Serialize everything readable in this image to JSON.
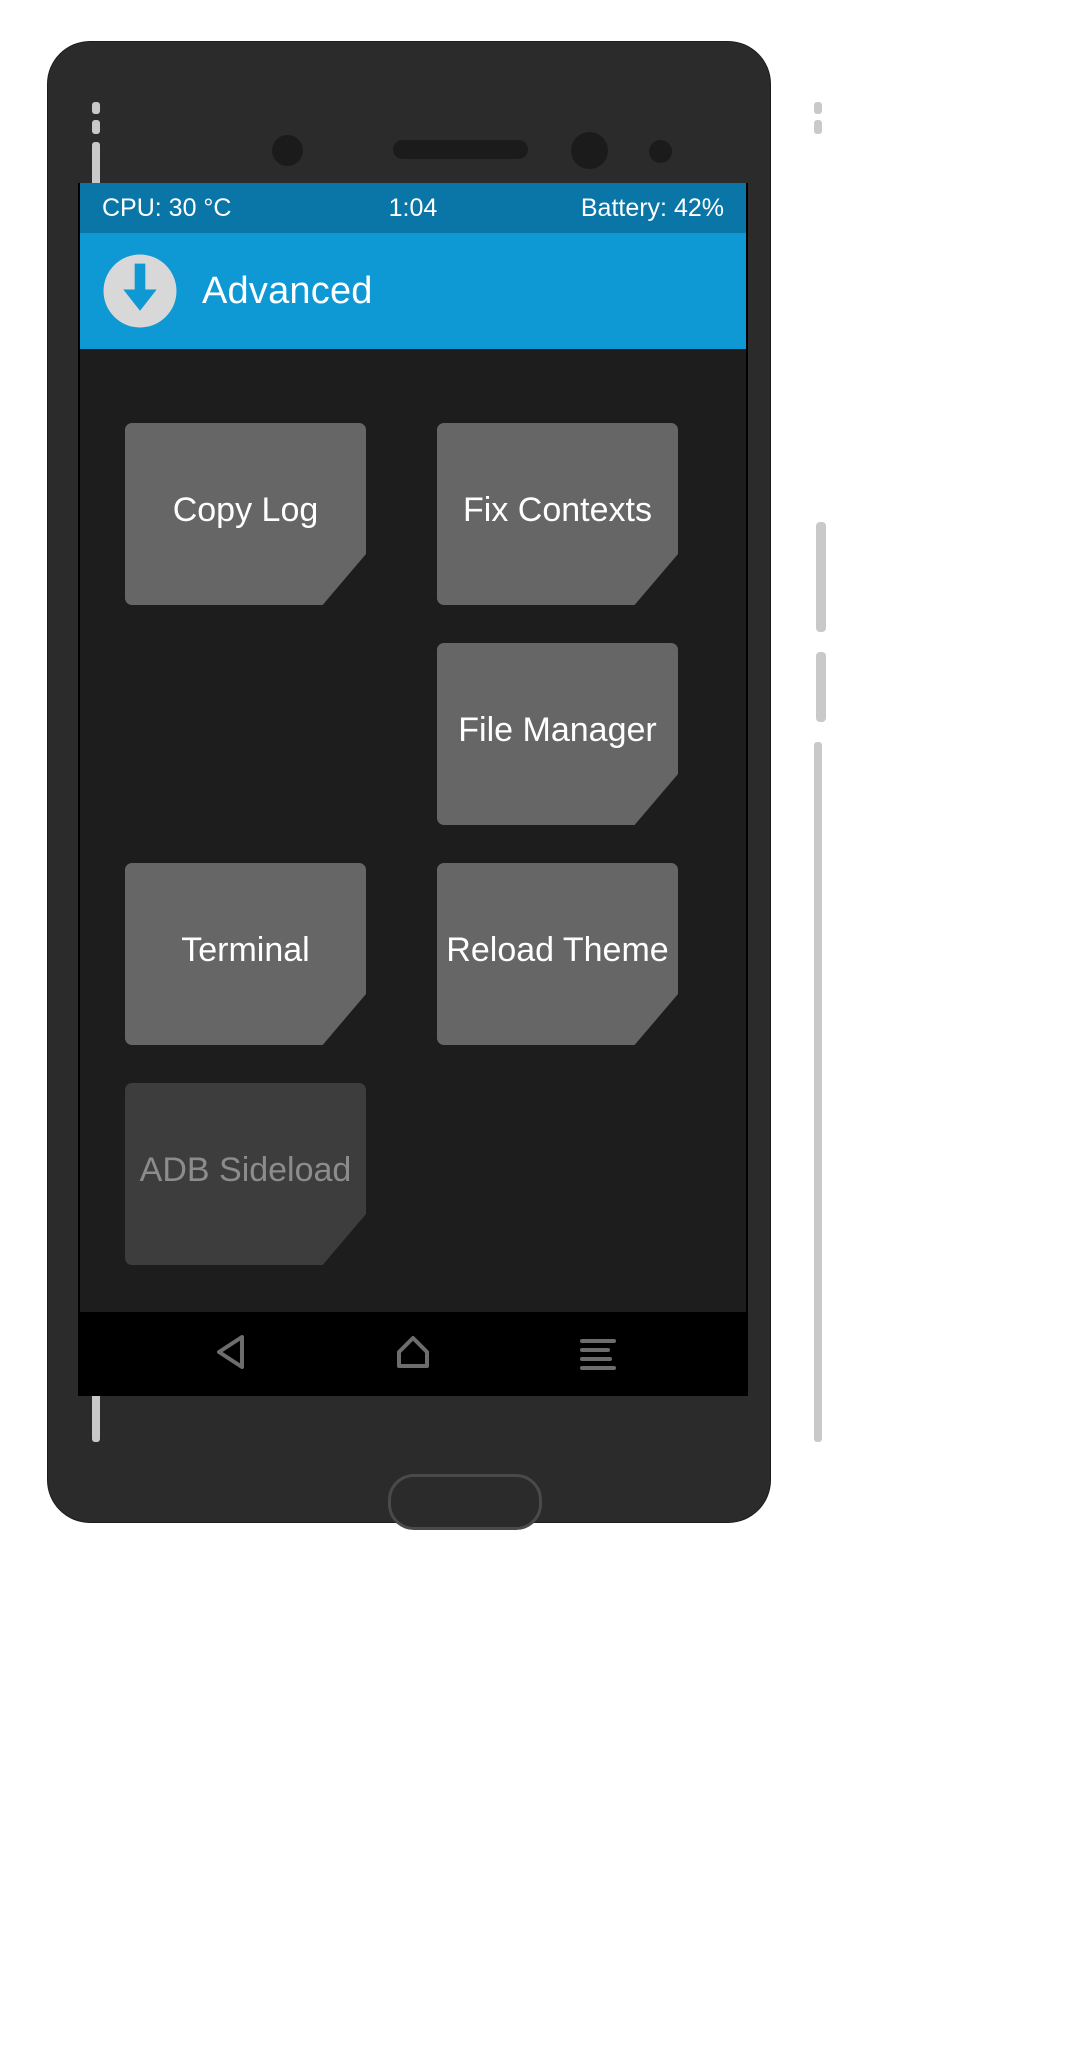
{
  "status_bar": {
    "cpu": "CPU: 30 °C",
    "clock": "1:04",
    "battery": "Battery: 42%"
  },
  "action_bar": {
    "title": "Advanced",
    "logo_icon": "twrp-logo-icon",
    "background_color": "#0e98d4"
  },
  "theme": {
    "status_bar_color": "#0a76a8",
    "accent_color": "#0e98d4",
    "screen_background": "#1d1d1d",
    "button_color": "#666666",
    "button_disabled_color": "#3d3d3d",
    "button_text_color": "#ffffff",
    "button_disabled_text_color": "#8c8c8c"
  },
  "buttons": [
    {
      "label": "Copy Log",
      "column": "left",
      "row": 0,
      "enabled": true
    },
    {
      "label": "Fix Contexts",
      "column": "right",
      "row": 0,
      "enabled": true
    },
    {
      "label": "File Manager",
      "column": "right",
      "row": 1,
      "enabled": true
    },
    {
      "label": "Terminal",
      "column": "left",
      "row": 2,
      "enabled": true
    },
    {
      "label": "Reload Theme",
      "column": "right",
      "row": 2,
      "enabled": true
    },
    {
      "label": "ADB Sideload",
      "column": "left",
      "row": 3,
      "enabled": false
    }
  ],
  "nav_bar": {
    "back_icon": "back-triangle-icon",
    "home_icon": "home-icon",
    "menu_icon": "menu-icon"
  }
}
